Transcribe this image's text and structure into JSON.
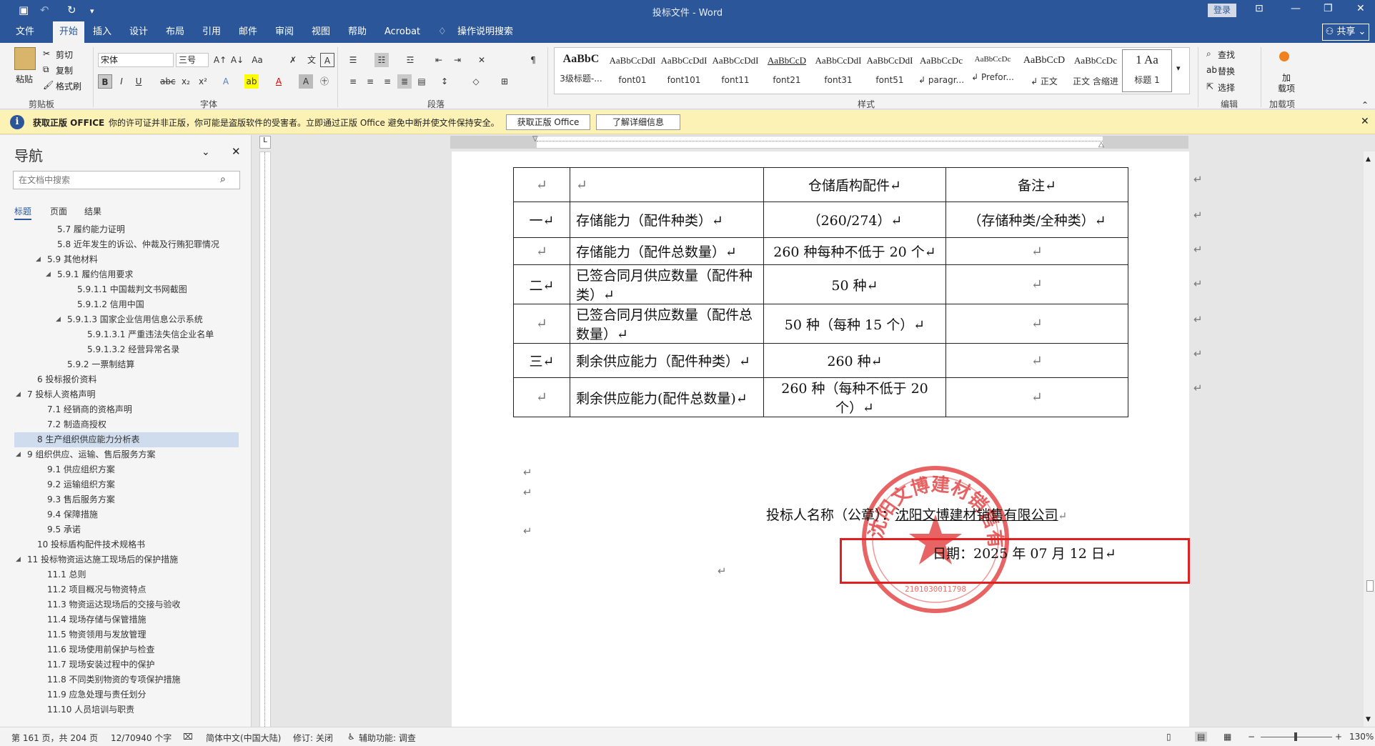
{
  "titlebar": {
    "doc_title": "投标文件 - Word",
    "login": "登录"
  },
  "tabs": [
    "文件",
    "开始",
    "插入",
    "设计",
    "布局",
    "引用",
    "邮件",
    "审阅",
    "视图",
    "帮助",
    "Acrobat"
  ],
  "tell_me": "操作说明搜索",
  "share": "共享",
  "ribbon": {
    "clipboard": {
      "paste": "粘贴",
      "cut": "剪切",
      "copy": "复制",
      "format_painter": "格式刷",
      "label": "剪贴板"
    },
    "font": {
      "name": "宋体",
      "size": "三号",
      "label": "字体"
    },
    "paragraph": {
      "label": "段落"
    },
    "styles": {
      "label": "样式",
      "items": [
        {
          "preview": "AaBbC",
          "name": "3级标题-..."
        },
        {
          "preview": "AaBbCcDdI",
          "name": "font01"
        },
        {
          "preview": "AaBbCcDdI",
          "name": "font101"
        },
        {
          "preview": "AaBbCcDdI",
          "name": "font11"
        },
        {
          "preview": "AaBbCcD",
          "name": "font21"
        },
        {
          "preview": "AaBbCcDdI",
          "name": "font31"
        },
        {
          "preview": "AaBbCcDdI",
          "name": "font51"
        },
        {
          "preview": "AaBbCcDc",
          "name": "↲ paragr..."
        },
        {
          "preview": "AaBbCcDc",
          "name": "↲ Prefor..."
        },
        {
          "preview": "AaBbCcD",
          "name": "↲ 正文"
        },
        {
          "preview": "AaBbCcDc",
          "name": "正文 含缩进"
        },
        {
          "preview": "1   Aa",
          "name": "标题 1"
        }
      ]
    },
    "editing": {
      "find": "查找",
      "replace": "替换",
      "select": "选择",
      "label": "编辑"
    },
    "addins": {
      "btn": "加\n载项",
      "label": "加载项"
    }
  },
  "infobar": {
    "title": "获取正版 OFFICE",
    "message": "你的许可证并非正版，你可能是盗版软件的受害者。立即通过正版 Office 避免中断并使文件保持安全。",
    "btn1": "获取正版 Office",
    "btn2": "了解详细信息"
  },
  "nav": {
    "title": "导航",
    "search_placeholder": "在文档中搜索",
    "tabs": [
      "标题",
      "页面",
      "结果"
    ],
    "items": [
      {
        "t": "5.7 履约能力证明",
        "l": 3,
        "tri": ""
      },
      {
        "t": "5.8 近年发生的诉讼、仲裁及行贿犯罪情况",
        "l": 3,
        "tri": ""
      },
      {
        "t": "5.9 其他材料",
        "l": 2,
        "tri": "◢"
      },
      {
        "t": "5.9.1 履约信用要求",
        "l": 3,
        "tri": "◢"
      },
      {
        "t": "5.9.1.1 中国裁判文书网截图",
        "l": 5,
        "tri": ""
      },
      {
        "t": "5.9.1.2 信用中国",
        "l": 5,
        "tri": ""
      },
      {
        "t": "5.9.1.3 国家企业信用信息公示系统",
        "l": 4,
        "tri": "◢"
      },
      {
        "t": "5.9.1.3.1 严重违法失信企业名单",
        "l": 6,
        "tri": ""
      },
      {
        "t": "5.9.1.3.2 经营异常名录",
        "l": 6,
        "tri": ""
      },
      {
        "t": "5.9.2 一票制结算",
        "l": 4,
        "tri": ""
      },
      {
        "t": "6 投标报价资料",
        "l": 1,
        "tri": ""
      },
      {
        "t": "7 投标人资格声明",
        "l": 0,
        "tri": "◢"
      },
      {
        "t": "7.1 经销商的资格声明",
        "l": 2,
        "tri": ""
      },
      {
        "t": "7.2 制造商授权",
        "l": 2,
        "tri": ""
      },
      {
        "t": "8 生产组织供应能力分析表",
        "l": 1,
        "tri": "",
        "sel": true
      },
      {
        "t": "9 组织供应、运输、售后服务方案",
        "l": 0,
        "tri": "◢"
      },
      {
        "t": "9.1 供应组织方案",
        "l": 2,
        "tri": ""
      },
      {
        "t": "9.2 运输组织方案",
        "l": 2,
        "tri": ""
      },
      {
        "t": "9.3 售后服务方案",
        "l": 2,
        "tri": ""
      },
      {
        "t": "9.4 保障措施",
        "l": 2,
        "tri": ""
      },
      {
        "t": "9.5 承诺",
        "l": 2,
        "tri": ""
      },
      {
        "t": "10 投标盾构配件技术规格书",
        "l": 1,
        "tri": ""
      },
      {
        "t": "11 投标物资运达施工现场后的保护措施",
        "l": 0,
        "tri": "◢"
      },
      {
        "t": "11.1 总则",
        "l": 2,
        "tri": ""
      },
      {
        "t": "11.2 项目概况与物资特点",
        "l": 2,
        "tri": ""
      },
      {
        "t": "11.3 物资运达现场后的交接与验收",
        "l": 2,
        "tri": ""
      },
      {
        "t": "11.4 现场存储与保管措施",
        "l": 2,
        "tri": ""
      },
      {
        "t": "11.5 物资领用与发放管理",
        "l": 2,
        "tri": ""
      },
      {
        "t": "11.6 现场使用前保护与检查",
        "l": 2,
        "tri": ""
      },
      {
        "t": "11.7 现场安装过程中的保护",
        "l": 2,
        "tri": ""
      },
      {
        "t": "11.8 不同类别物资的专项保护措施",
        "l": 2,
        "tri": ""
      },
      {
        "t": "11.9 应急处理与责任划分",
        "l": 2,
        "tri": ""
      },
      {
        "t": "11.10 人员培训与职责",
        "l": 2,
        "tri": ""
      }
    ]
  },
  "table": {
    "rows": [
      [
        "↵",
        "↵",
        "仓储盾构配件↵",
        "备注↵"
      ],
      [
        "一↵",
        "存储能力（配件种类）↵",
        "（260/274）↵",
        "（存储种类/全种类）↵"
      ],
      [
        "↵",
        "存储能力（配件总数量）↵",
        "260 种每种不低于 20 个↵",
        "↵"
      ],
      [
        "二↵",
        "已签合同月供应数量（配件种类）↵",
        "50 种↵",
        "↵"
      ],
      [
        "↵",
        "已签合同月供应数量（配件总数量）↵",
        "50 种（每种 15 个）↵",
        "↵"
      ],
      [
        "三↵",
        "剩余供应能力（配件种类）↵",
        "260 种↵",
        "↵"
      ],
      [
        "↵",
        "剩余供应能力(配件总数量)↵",
        "260 种（每种不低于 20 个）↵",
        "↵"
      ]
    ]
  },
  "doc": {
    "bidder_label": "投标人名称（公章）：",
    "bidder_name": "沈阳文博建材销售有限公司",
    "date": "日期：2025 年 07 月 12 日↵",
    "para_mark": "↵",
    "seal_text": "沈阳文博建材销售有限公司",
    "seal_number": "2101030011798"
  },
  "status": {
    "page": "第 161 页，共 204 页",
    "words": "12/70940 个字",
    "lang": "简体中文(中国大陆)",
    "revision": "修订: 关闭",
    "accessibility": "辅助功能: 调查",
    "zoom": "130%"
  }
}
